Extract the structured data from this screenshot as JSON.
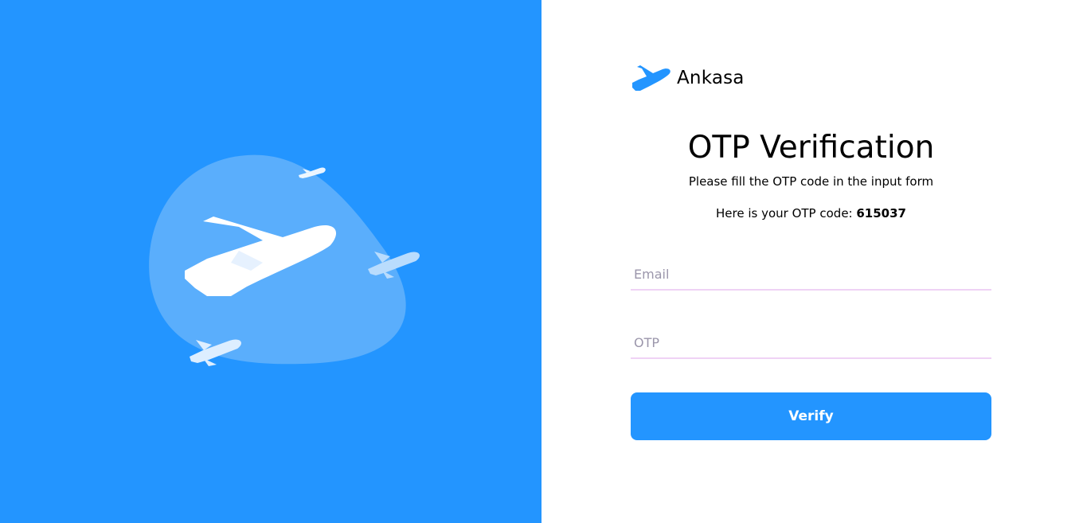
{
  "brand": {
    "name": "Ankasa",
    "logo_icon": "airplane-icon"
  },
  "hero": {
    "illustration": "airplanes-illustration",
    "background_color": "#2395ff",
    "blob_color": "#5aaefc"
  },
  "form": {
    "title": "OTP Verification",
    "subtitle": "Please fill the OTP code in the input form",
    "otp_prefix": "Here is your OTP code: ",
    "otp_code": "615037",
    "email_placeholder": "Email",
    "email_value": "",
    "otp_placeholder": "OTP",
    "otp_value": "",
    "verify_label": "Verify"
  },
  "colors": {
    "accent": "#2395ff",
    "input_underline": "#efd2f5",
    "placeholder": "#9b96ab"
  }
}
